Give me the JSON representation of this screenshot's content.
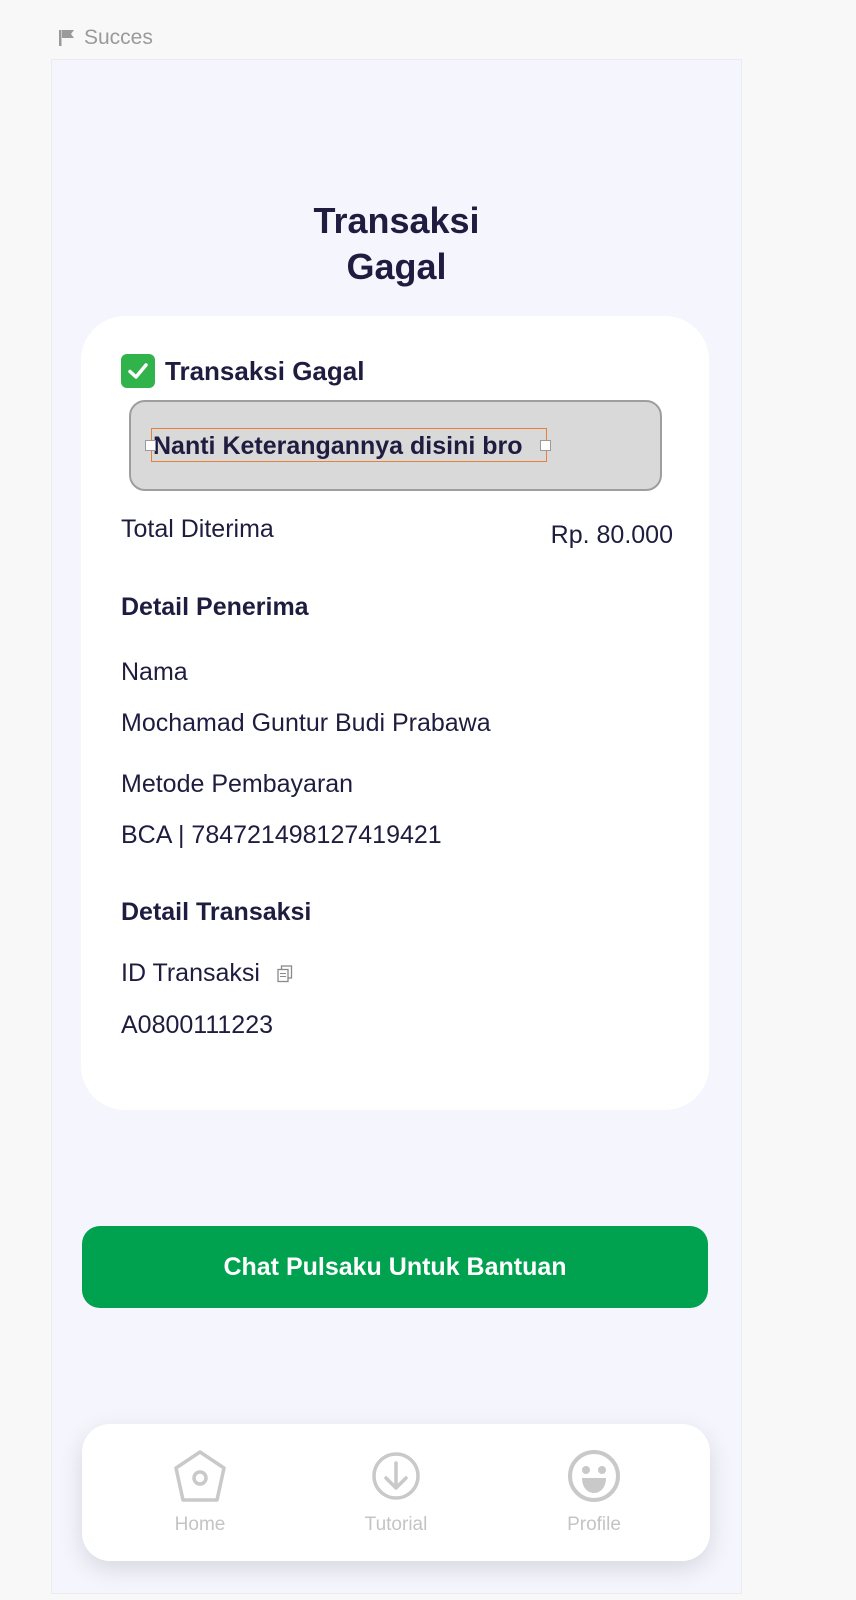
{
  "frame_label": "Succes",
  "page": {
    "title_line1": "Transaksi",
    "title_line2": "Gagal"
  },
  "card": {
    "status": {
      "icon": "check-box-icon",
      "text": "Transaksi Gagal"
    },
    "note": "Nanti Keterangannya disini bro",
    "total": {
      "label": "Total Diterima",
      "value": "Rp. 80.000"
    },
    "recipient": {
      "section_title": "Detail Penerima",
      "name_label": "Nama",
      "name_value": "Mochamad Guntur Budi Prabawa",
      "method_label": "Metode Pembayaran",
      "method_value": "BCA | 784721498127419421"
    },
    "transaction": {
      "section_title": "Detail Transaksi",
      "id_label": "ID Transaksi",
      "id_value": "A0800111223"
    }
  },
  "cta_label": "Chat Pulsaku Untuk Bantuan",
  "nav": {
    "items": [
      {
        "label": "Home",
        "icon": "home-icon"
      },
      {
        "label": "Tutorial",
        "icon": "download-icon"
      },
      {
        "label": "Profile",
        "icon": "smiley-icon"
      }
    ]
  },
  "colors": {
    "background": "#f4f5fd",
    "primary_text": "#1f1d3f",
    "cta": "#00a14f",
    "status_check": "#2fb34a",
    "nav_inactive": "#c4c4c4"
  }
}
